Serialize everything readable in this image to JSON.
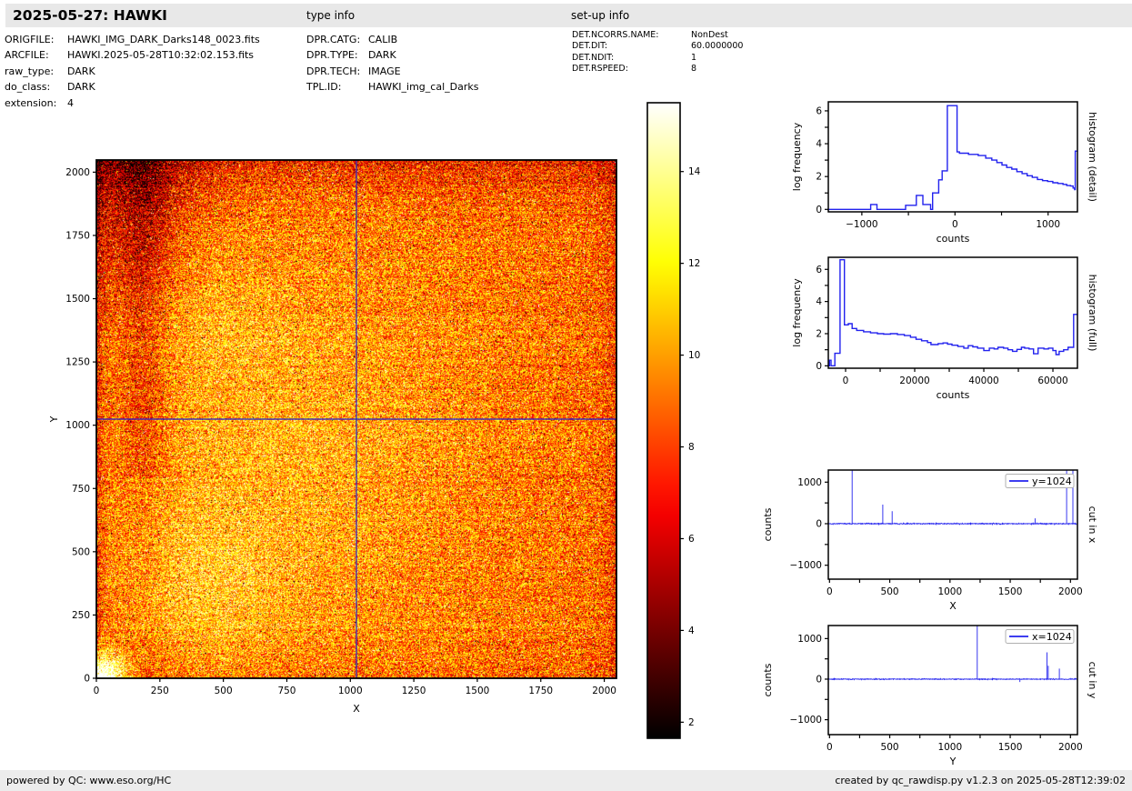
{
  "header": {
    "title": "2025-05-27: HAWKI",
    "type_info_label": "type info",
    "setup_info_label": "set-up info"
  },
  "file_info": {
    "rows": [
      {
        "label": "ORIGFILE:",
        "value": "HAWKI_IMG_DARK_Darks148_0023.fits"
      },
      {
        "label": "ARCFILE:",
        "value": "HAWKI.2025-05-28T10:32:02.153.fits"
      },
      {
        "label": "raw_type:",
        "value": "DARK"
      },
      {
        "label": "do_class:",
        "value": "DARK"
      },
      {
        "label": "extension:",
        "value": "4"
      }
    ]
  },
  "type_info": {
    "rows": [
      {
        "label": "DPR.CATG:",
        "value": "CALIB"
      },
      {
        "label": "DPR.TYPE:",
        "value": "DARK"
      },
      {
        "label": "DPR.TECH:",
        "value": "IMAGE"
      },
      {
        "label": "TPL.ID:",
        "value": "HAWKI_img_cal_Darks"
      }
    ]
  },
  "setup_info": {
    "rows": [
      {
        "label": "DET.NCORRS.NAME:",
        "value": "NonDest"
      },
      {
        "label": "DET.DIT:",
        "value": "60.0000000"
      },
      {
        "label": "DET.NDIT:",
        "value": "1"
      },
      {
        "label": "DET.RSPEED:",
        "value": "8"
      }
    ]
  },
  "footer": {
    "left": "powered by QC: www.eso.org/HC",
    "right": "created by qc_rawdisp.py v1.2.3 on 2025-05-28T12:39:02"
  },
  "colors": {
    "series_blue": "#2222ee",
    "crosshair_blue": "#2222cc",
    "spine": "#000000",
    "topbar_bg": "#e8e8e8",
    "footer_bg": "#ececec",
    "legend_border": "#b0b0b0"
  },
  "chart_data": [
    {
      "id": "main_image",
      "type": "heatmap",
      "xlabel": "X",
      "ylabel": "Y",
      "xlim": [
        0,
        2048
      ],
      "ylim": [
        0,
        2048
      ],
      "xticks": [
        0,
        250,
        500,
        750,
        1000,
        1250,
        1500,
        1750,
        2000
      ],
      "yticks": [
        0,
        250,
        500,
        750,
        1000,
        1250,
        1500,
        1750,
        2000
      ],
      "colormap": "hot",
      "value_range": [
        1.65,
        15.5
      ],
      "crosshair": {
        "x": 1024,
        "y": 1024
      },
      "background_level": 9.0,
      "noise": {
        "seed": 42,
        "amp": 3.4,
        "spike_prob": 0.07,
        "spike_extra": [
          3,
          7
        ],
        "row_amp": 0.55
      },
      "bright_blobs": [
        [
          420,
          380,
          330,
          300,
          1.6
        ],
        [
          750,
          900,
          750,
          850,
          1.7
        ],
        [
          380,
          1420,
          300,
          260,
          1.0
        ]
      ],
      "dark_top_left": [
        110,
        2048,
        280,
        560,
        -2.6
      ],
      "dark_band_x": [
        185,
        95,
        -1.9
      ],
      "edge_dark": {
        "left": [
          25,
          -2.4
        ],
        "right": [
          45,
          -1.6
        ],
        "top": [
          90,
          -2.4
        ],
        "bottom": [
          60,
          -0.6
        ]
      },
      "hot_corner": [
        0,
        0,
        105,
        95,
        10
      ]
    },
    {
      "id": "colorbar",
      "type": "colorbar",
      "colormap": "hot",
      "vmin": 1.65,
      "vmax": 15.5,
      "ticks": [
        2,
        4,
        6,
        8,
        10,
        12,
        14
      ]
    },
    {
      "id": "hist_detail",
      "type": "line",
      "style": "steps",
      "xlabel": "counts",
      "ylabel": "log frequency",
      "side_label": "histogram (detail)",
      "xlim": [
        -1360,
        1315
      ],
      "ylim": [
        -0.15,
        6.55
      ],
      "xticks_major": [
        -1000,
        0,
        1000
      ],
      "xticks_minor": [
        -500,
        500
      ],
      "yticks_major": [
        0,
        2,
        4,
        6
      ],
      "yticks_minor": [
        1,
        3,
        5
      ],
      "steps": [
        [
          -1360,
          0
        ],
        [
          -905,
          0.3
        ],
        [
          -838,
          0
        ],
        [
          -530,
          0.25
        ],
        [
          -415,
          0.85
        ],
        [
          -345,
          0.3
        ],
        [
          -262,
          0
        ],
        [
          -240,
          1.0
        ],
        [
          -175,
          1.8
        ],
        [
          -138,
          2.35
        ],
        [
          -82,
          6.32
        ],
        [
          22,
          3.5
        ],
        [
          48,
          3.42
        ],
        [
          145,
          3.35
        ],
        [
          250,
          3.28
        ],
        [
          330,
          3.12
        ],
        [
          395,
          3.0
        ],
        [
          450,
          2.85
        ],
        [
          505,
          2.7
        ],
        [
          555,
          2.55
        ],
        [
          610,
          2.45
        ],
        [
          665,
          2.3
        ],
        [
          720,
          2.18
        ],
        [
          775,
          2.05
        ],
        [
          830,
          1.95
        ],
        [
          885,
          1.82
        ],
        [
          940,
          1.75
        ],
        [
          995,
          1.7
        ],
        [
          1050,
          1.62
        ],
        [
          1105,
          1.58
        ],
        [
          1160,
          1.52
        ],
        [
          1200,
          1.45
        ],
        [
          1240,
          1.42
        ],
        [
          1268,
          1.3
        ],
        [
          1285,
          1.2
        ],
        [
          1292,
          3.55
        ],
        [
          1315,
          3.55
        ]
      ]
    },
    {
      "id": "hist_full",
      "type": "line",
      "style": "steps",
      "xlabel": "counts",
      "ylabel": "log frequency",
      "side_label": "histogram (full)",
      "xlim": [
        -5000,
        67100
      ],
      "ylim": [
        -0.15,
        6.75
      ],
      "xticks_major": [
        0,
        20000,
        40000,
        60000
      ],
      "xticks_minor": [
        10000,
        30000,
        50000
      ],
      "yticks_major": [
        0,
        2,
        4,
        6
      ],
      "yticks_minor": [
        1,
        3,
        5
      ],
      "steps": [
        [
          -5000,
          0
        ],
        [
          -4650,
          0.35
        ],
        [
          -4200,
          0
        ],
        [
          -3100,
          0.78
        ],
        [
          -1600,
          6.6
        ],
        [
          -350,
          2.55
        ],
        [
          800,
          2.62
        ],
        [
          1900,
          2.32
        ],
        [
          3200,
          2.2
        ],
        [
          5200,
          2.12
        ],
        [
          7200,
          2.05
        ],
        [
          9200,
          2.0
        ],
        [
          11000,
          1.97
        ],
        [
          13000,
          2.0
        ],
        [
          15000,
          1.95
        ],
        [
          17000,
          1.88
        ],
        [
          18800,
          1.78
        ],
        [
          20400,
          1.65
        ],
        [
          22000,
          1.56
        ],
        [
          23700,
          1.45
        ],
        [
          24700,
          1.32
        ],
        [
          26800,
          1.38
        ],
        [
          28200,
          1.42
        ],
        [
          29500,
          1.35
        ],
        [
          30800,
          1.28
        ],
        [
          32500,
          1.2
        ],
        [
          34200,
          1.1
        ],
        [
          35500,
          1.25
        ],
        [
          36800,
          1.18
        ],
        [
          38200,
          1.1
        ],
        [
          40000,
          0.95
        ],
        [
          41600,
          1.1
        ],
        [
          43000,
          1.05
        ],
        [
          44100,
          1.15
        ],
        [
          45700,
          1.1
        ],
        [
          47000,
          1.0
        ],
        [
          48300,
          0.9
        ],
        [
          49600,
          1.02
        ],
        [
          50900,
          1.15
        ],
        [
          51800,
          1.1
        ],
        [
          53100,
          1.05
        ],
        [
          54400,
          0.75
        ],
        [
          55700,
          1.1
        ],
        [
          57400,
          1.05
        ],
        [
          58700,
          1.1
        ],
        [
          60000,
          0.95
        ],
        [
          60900,
          0.7
        ],
        [
          61800,
          0.9
        ],
        [
          63100,
          1.0
        ],
        [
          64400,
          1.15
        ],
        [
          65500,
          1.15
        ],
        [
          66000,
          3.2
        ],
        [
          67100,
          3.2
        ]
      ]
    },
    {
      "id": "cut_x",
      "type": "line",
      "style": "noisy",
      "xlabel": "X",
      "ylabel": "counts",
      "side_label": "cut in x",
      "legend": "y=1024",
      "xlim": [
        -10,
        2058
      ],
      "ylim": [
        -1335,
        1291
      ],
      "xticks_major": [
        0,
        500,
        1000,
        1500,
        2000
      ],
      "xticks_minor": [
        250,
        750,
        1250,
        1750
      ],
      "yticks_major": [
        -1000,
        0,
        1000
      ],
      "yticks_minor": [
        -500,
        500
      ],
      "noise": {
        "seed": 7,
        "amp": 18
      },
      "spikes": [
        [
          188,
          1350
        ],
        [
          442,
          460
        ],
        [
          520,
          300
        ],
        [
          1706,
          130
        ],
        [
          1968,
          1350
        ],
        [
          2020,
          1350
        ]
      ]
    },
    {
      "id": "cut_y",
      "type": "line",
      "style": "noisy",
      "xlabel": "Y",
      "ylabel": "counts",
      "side_label": "cut in y",
      "legend": "x=1024",
      "xlim": [
        -10,
        2058
      ],
      "ylim": [
        -1368,
        1322
      ],
      "xticks_major": [
        0,
        500,
        1000,
        1500,
        2000
      ],
      "xticks_minor": [
        250,
        750,
        1250,
        1750
      ],
      "yticks_major": [
        -1000,
        0,
        1000
      ],
      "yticks_minor": [
        -500,
        500
      ],
      "noise": {
        "seed": 19,
        "amp": 15
      },
      "spikes": [
        [
          1226,
          1400
        ],
        [
          1580,
          -70
        ],
        [
          1805,
          660
        ],
        [
          1816,
          330
        ],
        [
          1908,
          260
        ]
      ]
    }
  ]
}
